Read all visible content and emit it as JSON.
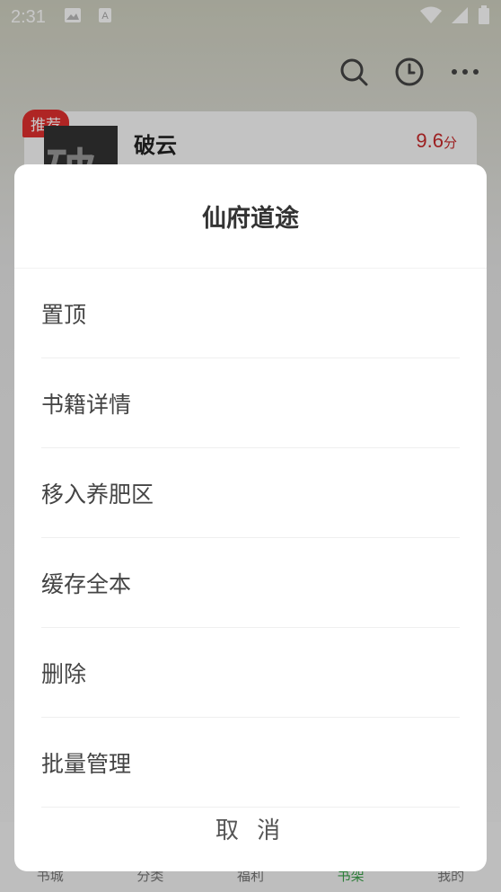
{
  "status_bar": {
    "time": "2:31",
    "icons": [
      "image-icon",
      "text-a-icon",
      "wifi-icon",
      "signal-icon",
      "battery-icon"
    ]
  },
  "toolbar": {
    "icons": [
      "search-icon",
      "history-clock-icon",
      "more-icon"
    ]
  },
  "recommend_card": {
    "badge": "推荐",
    "title": "破云",
    "cover_char": "破",
    "score": "9.6",
    "score_unit": "分"
  },
  "bottom_nav": {
    "items": [
      "书城",
      "分类",
      "福利",
      "书架",
      "我的"
    ],
    "active_index": 3,
    "active_color": "#3aa24a"
  },
  "sheet": {
    "title": "仙府道途",
    "items": [
      "置顶",
      "书籍详情",
      "移入养肥区",
      "缓存全本",
      "删除",
      "批量管理"
    ],
    "cancel_label": "取 消"
  },
  "colors": {
    "accent_red": "#c8292b",
    "badge_red": "#e0302f"
  }
}
